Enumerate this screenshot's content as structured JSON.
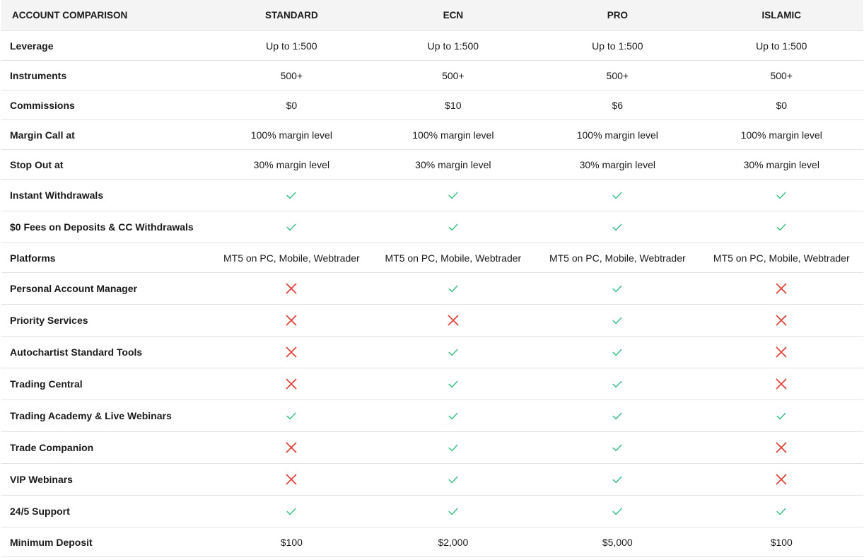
{
  "header": {
    "title": "ACCOUNT COMPARISON",
    "columns": [
      "STANDARD",
      "ECN",
      "PRO",
      "ISLAMIC"
    ]
  },
  "colors": {
    "check": "#3cbf86",
    "cross": "#e0453c",
    "header_bg": "#f4f4f4",
    "divider": "#e3e3e3"
  },
  "rows": [
    {
      "label": "Leverage",
      "type": "text",
      "values": [
        "Up to 1:500",
        "Up to 1:500",
        "Up to 1:500",
        "Up to 1:500"
      ]
    },
    {
      "label": "Instruments",
      "type": "text",
      "values": [
        "500+",
        "500+",
        "500+",
        "500+"
      ]
    },
    {
      "label": "Commissions",
      "type": "text",
      "values": [
        "$0",
        "$10",
        "$6",
        "$0"
      ]
    },
    {
      "label": "Margin Call at",
      "type": "text",
      "values": [
        "100% margin level",
        "100% margin level",
        "100% margin level",
        "100% margin level"
      ]
    },
    {
      "label": "Stop Out at",
      "type": "text",
      "values": [
        "30% margin level",
        "30% margin level",
        "30% margin level",
        "30% margin level"
      ]
    },
    {
      "label": "Instant Withdrawals",
      "type": "icon",
      "values": [
        "check-icon",
        "check-icon",
        "check-icon",
        "check-icon"
      ]
    },
    {
      "label": "$0 Fees on Deposits & CC Withdrawals",
      "type": "icon",
      "values": [
        "check-icon",
        "check-icon",
        "check-icon",
        "check-icon"
      ]
    },
    {
      "label": "Platforms",
      "type": "text",
      "values": [
        "MT5 on PC, Mobile, Webtrader",
        "MT5 on PC, Mobile, Webtrader",
        "MT5 on PC, Mobile, Webtrader",
        "MT5 on PC, Mobile, Webtrader"
      ]
    },
    {
      "label": "Personal Account Manager",
      "type": "icon",
      "values": [
        "cross-icon",
        "check-icon",
        "check-icon",
        "cross-icon"
      ]
    },
    {
      "label": "Priority Services",
      "type": "icon",
      "values": [
        "cross-icon",
        "cross-icon",
        "check-icon",
        "cross-icon"
      ]
    },
    {
      "label": "Autochartist Standard Tools",
      "type": "icon",
      "values": [
        "cross-icon",
        "check-icon",
        "check-icon",
        "cross-icon"
      ]
    },
    {
      "label": "Trading Central",
      "type": "icon",
      "values": [
        "cross-icon",
        "check-icon",
        "check-icon",
        "cross-icon"
      ]
    },
    {
      "label": "Trading Academy & Live Webinars",
      "type": "icon",
      "values": [
        "check-icon",
        "check-icon",
        "check-icon",
        "check-icon"
      ]
    },
    {
      "label": "Trade Companion",
      "type": "icon",
      "values": [
        "cross-icon",
        "check-icon",
        "check-icon",
        "cross-icon"
      ]
    },
    {
      "label": "VIP Webinars",
      "type": "icon",
      "values": [
        "cross-icon",
        "check-icon",
        "check-icon",
        "cross-icon"
      ]
    },
    {
      "label": "24/5 Support",
      "type": "icon",
      "values": [
        "check-icon",
        "check-icon",
        "check-icon",
        "check-icon"
      ]
    },
    {
      "label": "Minimum Deposit",
      "type": "text",
      "values": [
        "$100",
        "$2,000",
        "$5,000",
        "$100"
      ]
    }
  ]
}
